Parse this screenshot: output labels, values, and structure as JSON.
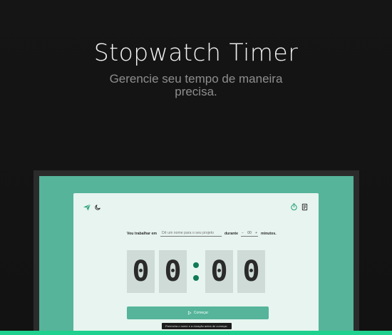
{
  "hero": {
    "title": "Stopwatch Timer",
    "subtitle_line1": "Gerencie seu tempo de maneira",
    "subtitle_line2": "precisa."
  },
  "app": {
    "form": {
      "prefix": "Vou trabalhar em",
      "project_placeholder": "Dê um nome para o seu projeto",
      "during": "durante",
      "minutes_value": "00",
      "minutes_suffix": "minutos."
    },
    "timer": {
      "d1": "0",
      "d2": "0",
      "d3": "0",
      "d4": "0"
    },
    "start_label": "Começar",
    "tooltip": "Preencha o nome e a duração antes de começar."
  },
  "icons": {
    "logo": "paper-plane-icon",
    "theme": "moon-icon",
    "timer": "timer-icon",
    "history": "history-icon"
  },
  "colors": {
    "accent": "#55b49a",
    "accent_dark": "#0f7a55",
    "bottom_bar": "#1fd18e"
  }
}
